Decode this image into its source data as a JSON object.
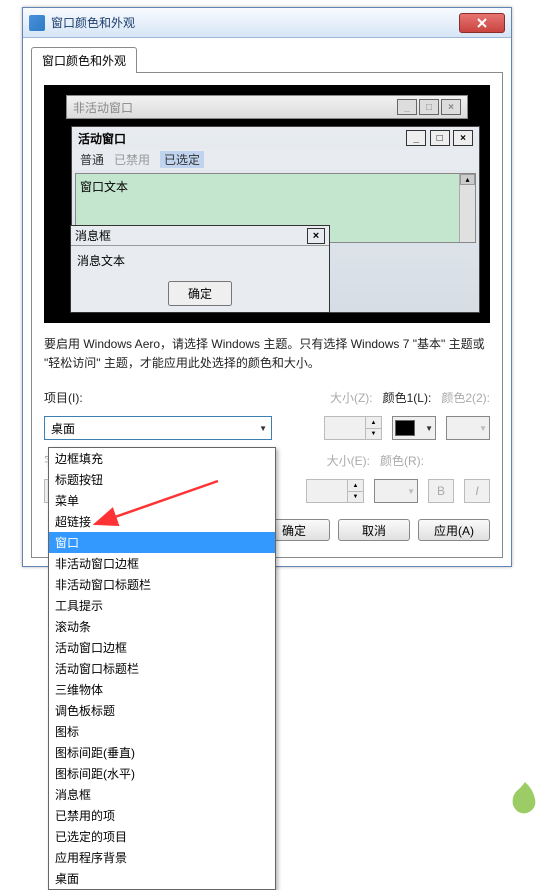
{
  "titlebar": {
    "text": "窗口颜色和外观"
  },
  "tab": {
    "label": "窗口颜色和外观"
  },
  "preview": {
    "inactive_title": "非活动窗口",
    "active_title": "活动窗口",
    "menu_normal": "普通",
    "menu_disabled": "已禁用",
    "menu_selected": "已选定",
    "window_text": "窗口文本",
    "msgbox_title": "消息框",
    "msgbox_text": "消息文本",
    "msgbox_ok": "确定"
  },
  "help_text": "要启用 Windows Aero，请选择 Windows 主题。只有选择 Windows 7 \"基本\" 主题或 \"轻松访问\" 主题，才能应用此处选择的颜色和大小。",
  "labels": {
    "item": "项目(I):",
    "size": "大小(Z):",
    "color1": "颜色1(L):",
    "color2": "颜色2(2):",
    "font": "字体(F):",
    "size2": "大小(E):",
    "color": "颜色(R):"
  },
  "combo": {
    "selected": "桌面"
  },
  "dropdown_items": [
    "边框填充",
    "标题按钮",
    "菜单",
    "超链接",
    "窗口",
    "非活动窗口边框",
    "非活动窗口标题栏",
    "工具提示",
    "滚动条",
    "活动窗口边框",
    "活动窗口标题栏",
    "三维物体",
    "调色板标题",
    "图标",
    "图标间距(垂直)",
    "图标间距(水平)",
    "消息框",
    "已禁用的项",
    "已选定的项目",
    "应用程序背景",
    "桌面"
  ],
  "dropdown_highlighted_index": 4,
  "color1_value": "#000000",
  "buttons": {
    "ok": "确定",
    "cancel": "取消",
    "apply": "应用(A)",
    "bold": "B",
    "italic": "I"
  }
}
